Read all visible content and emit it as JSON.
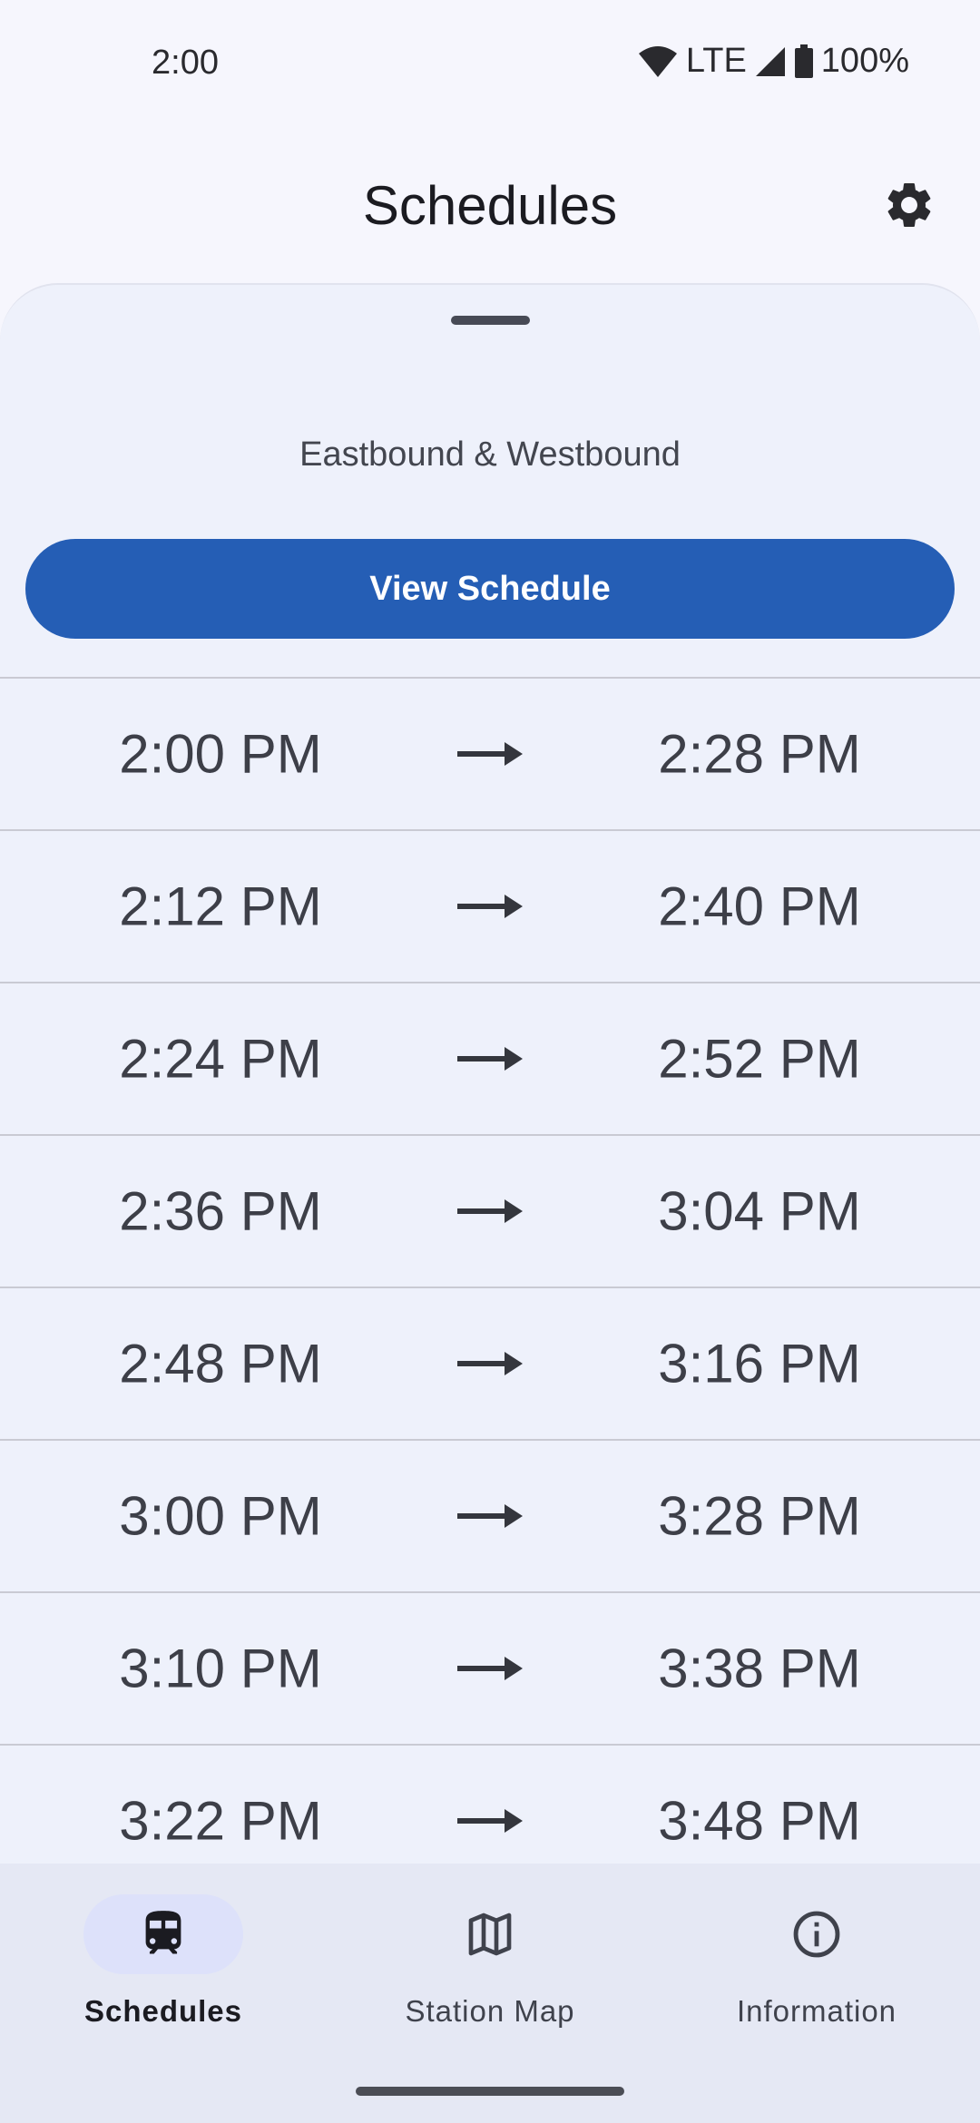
{
  "status_bar": {
    "time": "2:00",
    "network": "LTE",
    "battery": "100%",
    "icons": [
      "wifi-icon",
      "signal-icon",
      "battery-icon"
    ]
  },
  "app_bar": {
    "title": "Schedules",
    "settings_icon": "gear-icon"
  },
  "sheet": {
    "subtitle": "Eastbound & Westbound",
    "view_button_label": "View Schedule",
    "trips": [
      {
        "depart": "2:00 PM",
        "arrive": "2:28 PM"
      },
      {
        "depart": "2:12 PM",
        "arrive": "2:40 PM"
      },
      {
        "depart": "2:24 PM",
        "arrive": "2:52 PM"
      },
      {
        "depart": "2:36 PM",
        "arrive": "3:04 PM"
      },
      {
        "depart": "2:48 PM",
        "arrive": "3:16 PM"
      },
      {
        "depart": "3:00 PM",
        "arrive": "3:28 PM"
      },
      {
        "depart": "3:10 PM",
        "arrive": "3:38 PM"
      },
      {
        "depart": "3:22 PM",
        "arrive": "3:48 PM"
      }
    ]
  },
  "bottom_nav": {
    "items": [
      {
        "label": "Schedules",
        "icon": "train-icon",
        "active": true
      },
      {
        "label": "Station Map",
        "icon": "map-icon",
        "active": false
      },
      {
        "label": "Information",
        "icon": "info-icon",
        "active": false
      }
    ]
  },
  "colors": {
    "primary": "#255eb5",
    "background": "#f6f6fd",
    "sheet": "#eef1fb",
    "nav": "#e5e8f4",
    "active_pill": "#dde1fa"
  }
}
